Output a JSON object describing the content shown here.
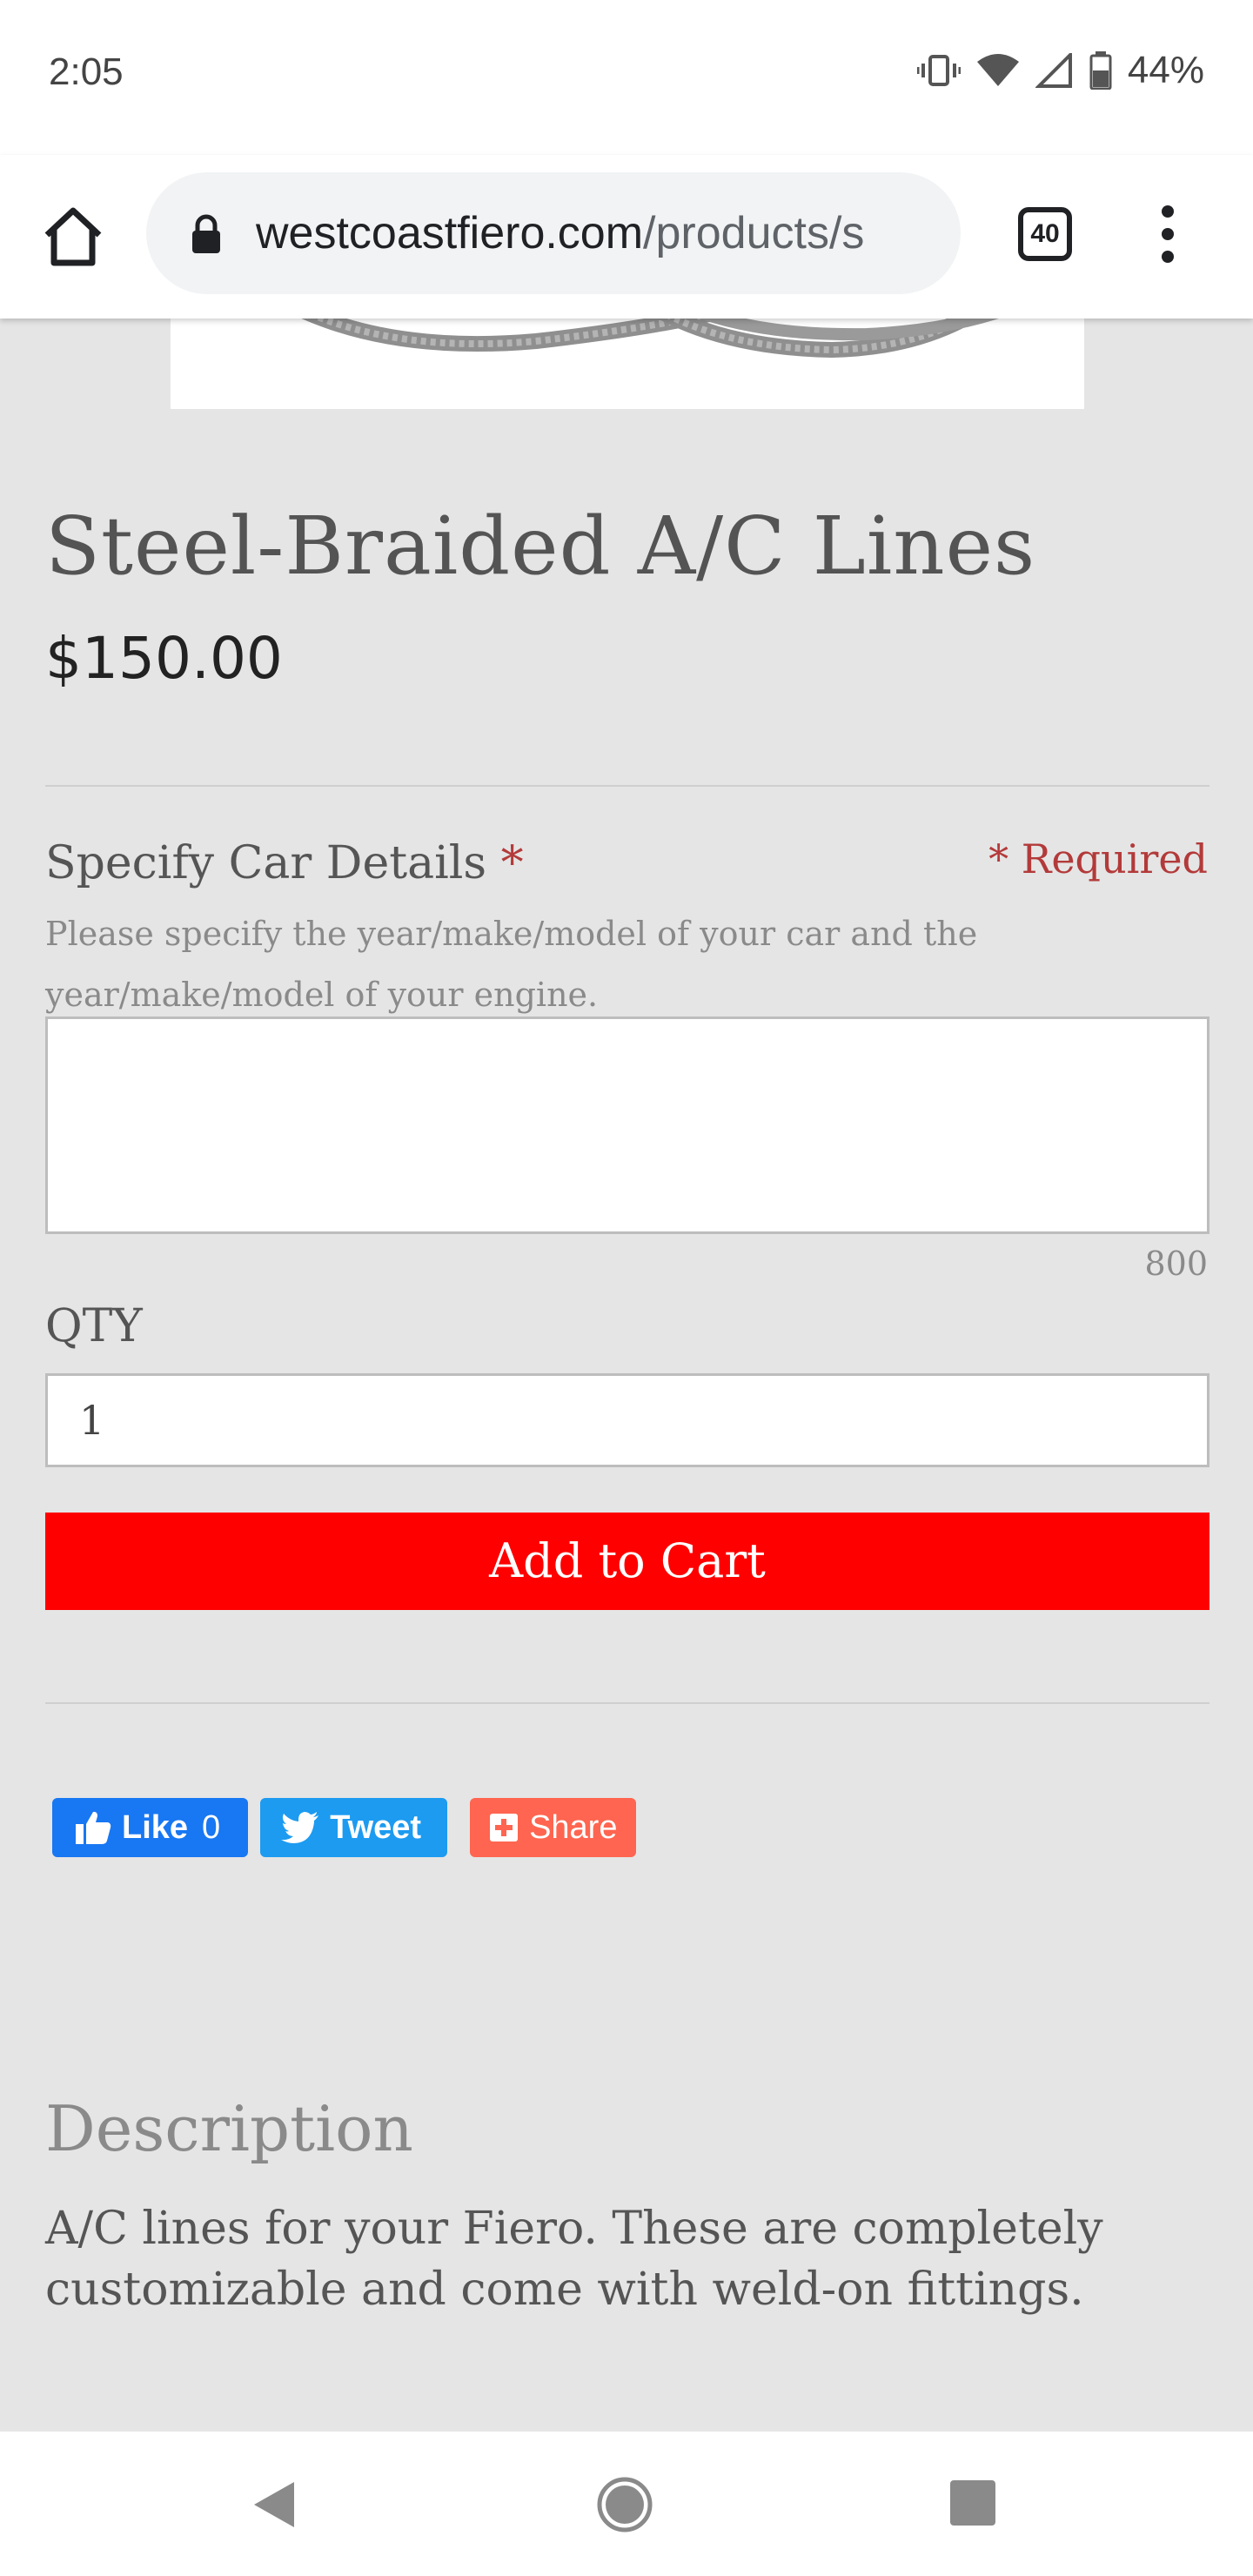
{
  "status_bar": {
    "time": "2:05",
    "battery": "44%"
  },
  "browser": {
    "url_domain": "westcoastfiero.com",
    "url_path": "/products/s",
    "tab_count": "40"
  },
  "product": {
    "title": "Steel-Braided A/C Lines",
    "price": "$150.00"
  },
  "form": {
    "car_details_label": "Specify Car Details",
    "required_star": "*",
    "required_note": "* Required",
    "help_text": "Please specify the year/make/model of your car and the year/make/model of your engine.",
    "textarea_value": "",
    "char_counter": "800",
    "qty_label": "QTY",
    "qty_value": "1",
    "add_to_cart_label": "Add to Cart"
  },
  "social": {
    "like_label": "Like",
    "like_count": "0",
    "tweet_label": "Tweet",
    "share_label": "Share"
  },
  "description": {
    "heading": "Description",
    "body": "A/C lines for your Fiero. These are completely customizable and come with weld-on fittings."
  },
  "colors": {
    "add_to_cart": "#ff0000",
    "required": "#b33a3a",
    "facebook": "#1877f2",
    "twitter": "#1d9bf0",
    "share": "#ff6550"
  }
}
